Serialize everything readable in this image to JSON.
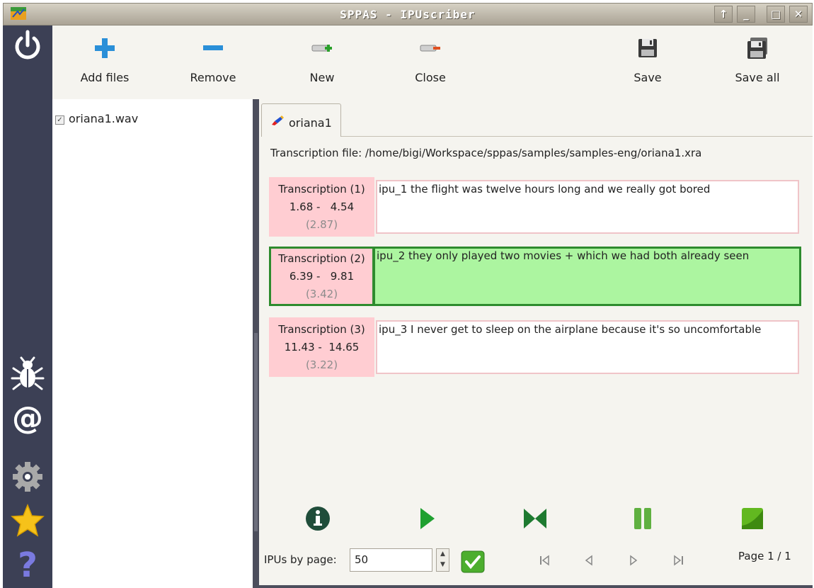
{
  "window": {
    "title": "SPPAS - IPUscriber",
    "buttons": [
      "↑",
      "_",
      "□",
      "✕"
    ]
  },
  "sidebar": {
    "icons": [
      "power-icon",
      "bug-icon",
      "at-icon",
      "gear-icon",
      "star-icon",
      "help-icon"
    ]
  },
  "toolbar": {
    "add_files": "Add files",
    "remove": "Remove",
    "new": "New",
    "close": "Close",
    "save": "Save",
    "save_all": "Save all"
  },
  "files": [
    {
      "name": "oriana1.wav",
      "checked": true
    }
  ],
  "tab": {
    "label": "oriana1"
  },
  "transcription_file": "Transcription file: /home/bigi/Workspace/sppas/samples/samples-eng/oriana1.xra",
  "ipus": [
    {
      "label": "Transcription (1)",
      "times": "1.68 -   4.54",
      "duration": "(2.87)",
      "text": "ipu_1 the flight was twelve hours long and we really got bored",
      "selected": false
    },
    {
      "label": "Transcription (2)",
      "times": "6.39 -   9.81",
      "duration": "(3.42)",
      "text": "ipu_2 they only played two movies + which we had both already seen",
      "selected": true
    },
    {
      "label": "Transcription (3)",
      "times": "11.43 -  14.65",
      "duration": "(3.22)",
      "text": "ipu_3 I never get to sleep on the airplane because it's so uncomfortable",
      "selected": false
    }
  ],
  "pagination": {
    "ipus_by_page_label": "IPUs by page:",
    "ipus_by_page_value": "50",
    "page_label": "Page 1 / 1"
  },
  "colors": {
    "sidebar": "#3c4055",
    "ipu_info": "#ffcdd2",
    "ipu_selected": "#acf5a0",
    "selected_border": "#2e8b2e"
  }
}
